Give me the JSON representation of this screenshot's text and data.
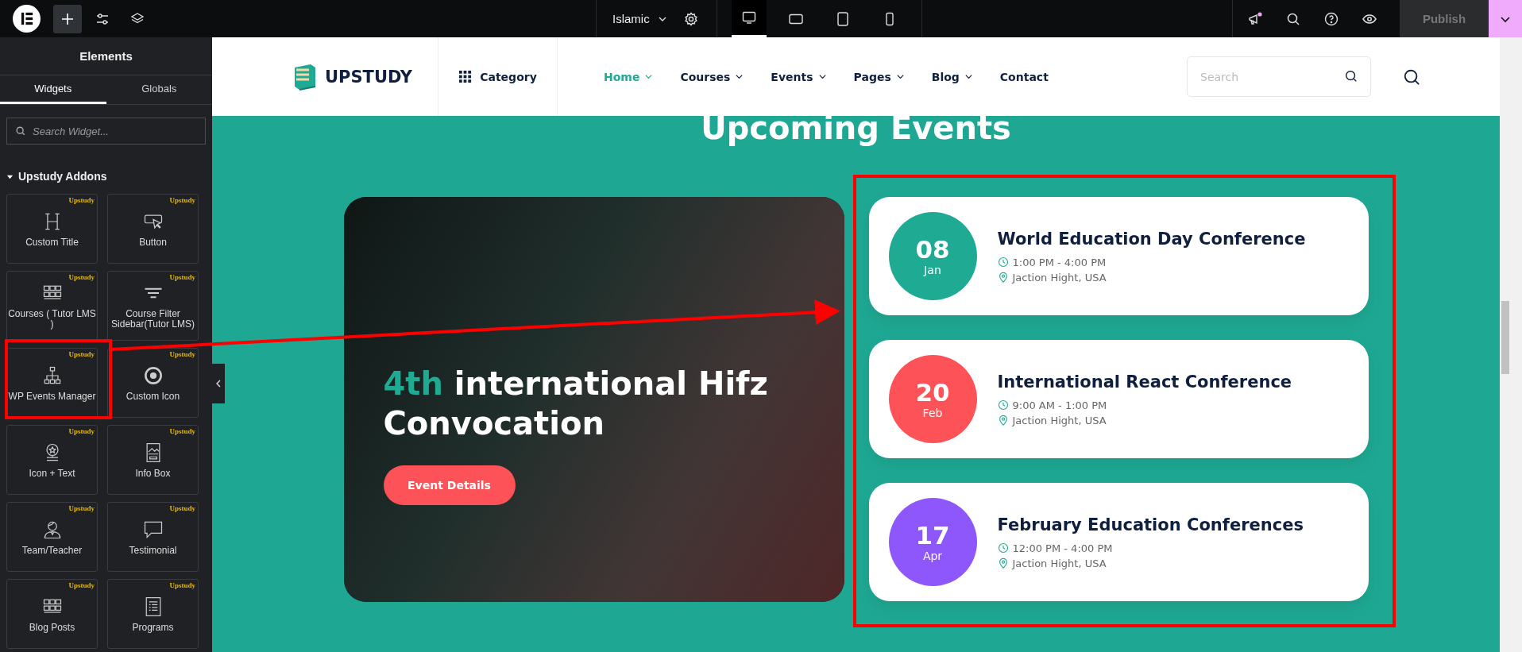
{
  "toolbar": {
    "site_selector": "Islamic",
    "devices": [
      {
        "kind": "desktop",
        "selected": true
      },
      {
        "kind": "tablet-landscape",
        "selected": false
      },
      {
        "kind": "tablet",
        "selected": false
      },
      {
        "kind": "mobile",
        "selected": false
      }
    ],
    "has_notification": true,
    "publish": "Publish"
  },
  "panel": {
    "title": "Elements",
    "tabs": [
      {
        "label": "Widgets",
        "selected": true
      },
      {
        "label": "Globals",
        "selected": false
      }
    ],
    "search": {
      "placeholder": "Search Widget..."
    },
    "section": {
      "label": "Upstudy Addons",
      "expanded": true
    },
    "widgets": [
      {
        "label": "Custom Title",
        "badge": "Upstudy",
        "kind": "heading"
      },
      {
        "label": "Button",
        "badge": "Upstudy",
        "kind": "pointer"
      },
      {
        "label": "Courses ( Tutor LMS )",
        "badge": "Upstudy",
        "kind": "grid"
      },
      {
        "label": "Course Filter Sidebar(Tutor LMS)",
        "badge": "Upstudy",
        "kind": "filter"
      },
      {
        "label": "WP Events Manager",
        "badge": "Upstudy",
        "kind": "sitemap"
      },
      {
        "label": "Custom Icon",
        "badge": "Upstudy",
        "kind": "target"
      },
      {
        "label": "Icon + Text",
        "badge": "Upstudy",
        "kind": "award"
      },
      {
        "label": "Info Box",
        "badge": "Upstudy",
        "kind": "infobox"
      },
      {
        "label": "Team/Teacher",
        "badge": "Upstudy",
        "kind": "person"
      },
      {
        "label": "Testimonial",
        "badge": "Upstudy",
        "kind": "speech"
      },
      {
        "label": "Blog Posts",
        "badge": "Upstudy",
        "kind": "grid"
      },
      {
        "label": "Programs",
        "badge": "Upstudy",
        "kind": "list"
      }
    ]
  },
  "site": {
    "logo": "UPSTUDY",
    "category": "Category",
    "nav": [
      {
        "label": "Home",
        "selected": true,
        "dropdown": true
      },
      {
        "label": "Courses",
        "selected": false,
        "dropdown": true
      },
      {
        "label": "Events",
        "selected": false,
        "dropdown": true
      },
      {
        "label": "Pages",
        "selected": false,
        "dropdown": true
      },
      {
        "label": "Blog",
        "selected": false,
        "dropdown": true
      },
      {
        "label": "Contact",
        "selected": false,
        "dropdown": false
      }
    ],
    "search": {
      "placeholder": "Search"
    }
  },
  "section": {
    "title": "Upcoming Events",
    "featured": {
      "highlight": "4th",
      "title": "international Hifz Convocation",
      "button": "Event Details"
    },
    "events": [
      {
        "day": "08",
        "month": "Jan",
        "color": "#1fab93",
        "title": "World Education Day Conference",
        "time": "1:00 PM - 4:00 PM",
        "location": "Jaction Hight, USA"
      },
      {
        "day": "20",
        "month": "Feb",
        "color": "#fd5257",
        "title": "International React Conference",
        "time": "9:00 AM - 1:00 PM",
        "location": "Jaction Hight, USA"
      },
      {
        "day": "17",
        "month": "Apr",
        "color": "#8d57fb",
        "title": "February Education Conferences",
        "time": "12:00 PM - 4:00 PM",
        "location": "Jaction Hight, USA"
      }
    ]
  }
}
